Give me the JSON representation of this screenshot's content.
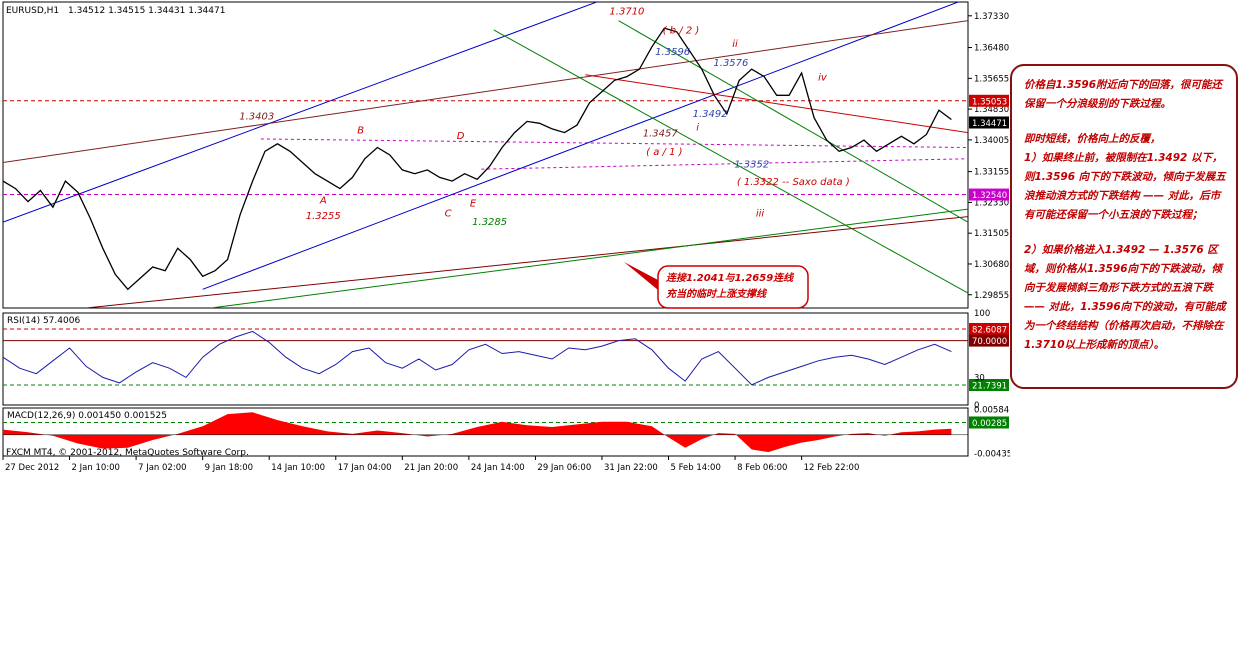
{
  "chart_data": {
    "type": "line",
    "symbol": "EURUSD,H1",
    "ohlc_readout": "1.34512 1.34515 1.34431 1.34471",
    "price_axis_ticks": [
      "1.37330",
      "1.36480",
      "1.35655",
      "1.34830",
      "1.34005",
      "1.33155",
      "1.32330",
      "1.31505",
      "1.30680",
      "1.29855"
    ],
    "price_badges": [
      {
        "value": "1.35053",
        "color": "#cc0000"
      },
      {
        "value": "1.34471",
        "color": "#000000"
      },
      {
        "value": "1.32540",
        "color": "#cc00cc"
      }
    ],
    "ylim": [
      1.295,
      1.377
    ],
    "series_close": [
      [
        0,
        1.329
      ],
      [
        3,
        1.327
      ],
      [
        6,
        1.3235
      ],
      [
        9,
        1.3265
      ],
      [
        12,
        1.322
      ],
      [
        15,
        1.329
      ],
      [
        18,
        1.326
      ],
      [
        21,
        1.319
      ],
      [
        24,
        1.311
      ],
      [
        27,
        1.304
      ],
      [
        30,
        1.3
      ],
      [
        33,
        1.303
      ],
      [
        36,
        1.306
      ],
      [
        39,
        1.305
      ],
      [
        42,
        1.311
      ],
      [
        45,
        1.308
      ],
      [
        48,
        1.3035
      ],
      [
        51,
        1.305
      ],
      [
        54,
        1.308
      ],
      [
        57,
        1.32
      ],
      [
        60,
        1.329
      ],
      [
        63,
        1.337
      ],
      [
        66,
        1.339
      ],
      [
        69,
        1.337
      ],
      [
        72,
        1.334
      ],
      [
        75,
        1.331
      ],
      [
        78,
        1.329
      ],
      [
        81,
        1.327
      ],
      [
        84,
        1.33
      ],
      [
        87,
        1.335
      ],
      [
        90,
        1.338
      ],
      [
        93,
        1.336
      ],
      [
        96,
        1.332
      ],
      [
        99,
        1.331
      ],
      [
        102,
        1.332
      ],
      [
        105,
        1.33
      ],
      [
        108,
        1.329
      ],
      [
        111,
        1.331
      ],
      [
        114,
        1.3295
      ],
      [
        117,
        1.333
      ],
      [
        120,
        1.338
      ],
      [
        123,
        1.342
      ],
      [
        126,
        1.345
      ],
      [
        129,
        1.3445
      ],
      [
        132,
        1.343
      ],
      [
        135,
        1.342
      ],
      [
        138,
        1.344
      ],
      [
        141,
        1.35
      ],
      [
        144,
        1.353
      ],
      [
        147,
        1.356
      ],
      [
        150,
        1.357
      ],
      [
        153,
        1.359
      ],
      [
        156,
        1.365
      ],
      [
        159,
        1.37
      ],
      [
        162,
        1.369
      ],
      [
        165,
        1.364
      ],
      [
        168,
        1.359
      ],
      [
        171,
        1.352
      ],
      [
        174,
        1.347
      ],
      [
        177,
        1.356
      ],
      [
        180,
        1.359
      ],
      [
        183,
        1.357
      ],
      [
        186,
        1.352
      ],
      [
        189,
        1.352
      ],
      [
        192,
        1.358
      ],
      [
        195,
        1.346
      ],
      [
        198,
        1.34
      ],
      [
        201,
        1.337
      ],
      [
        204,
        1.338
      ],
      [
        207,
        1.34
      ],
      [
        210,
        1.337
      ],
      [
        213,
        1.339
      ],
      [
        216,
        1.341
      ],
      [
        219,
        1.339
      ],
      [
        222,
        1.3415
      ],
      [
        225,
        1.348
      ],
      [
        228,
        1.3455
      ]
    ],
    "x_ticks": [
      {
        "i": 0,
        "label": "27 Dec 2012"
      },
      {
        "i": 16,
        "label": "2 Jan 10:00"
      },
      {
        "i": 32,
        "label": "7 Jan 02:00"
      },
      {
        "i": 48,
        "label": "9 Jan 18:00"
      },
      {
        "i": 64,
        "label": "14 Jan 10:00"
      },
      {
        "i": 80,
        "label": "17 Jan 04:00"
      },
      {
        "i": 96,
        "label": "21 Jan 20:00"
      },
      {
        "i": 112,
        "label": "24 Jan 14:00"
      },
      {
        "i": 128,
        "label": "29 Jan 06:00"
      },
      {
        "i": 144,
        "label": "31 Jan 22:00"
      },
      {
        "i": 160,
        "label": "5 Feb 14:00"
      },
      {
        "i": 176,
        "label": "8 Feb 06:00"
      },
      {
        "i": 192,
        "label": "12 Feb 22:00"
      }
    ],
    "x_max": 232,
    "trendlines": [
      {
        "p1": [
          0,
          1.318
        ],
        "p2": [
          150,
          1.38
        ],
        "color": "#0000cc"
      },
      {
        "p1": [
          48,
          1.3
        ],
        "p2": [
          232,
          1.378
        ],
        "color": "#0000cc"
      },
      {
        "p1": [
          0,
          1.334
        ],
        "p2": [
          232,
          1.372
        ],
        "color": "#802020"
      },
      {
        "p1": [
          140,
          1.3575
        ],
        "p2": [
          232,
          1.342
        ],
        "color": "#cc0000"
      },
      {
        "p1": [
          20,
          1.295
        ],
        "p2": [
          232,
          1.3195
        ],
        "color": "#800000"
      },
      {
        "p1": [
          50,
          1.295
        ],
        "p2": [
          232,
          1.3215
        ],
        "color": "#008000"
      },
      {
        "p1": [
          118,
          1.3695
        ],
        "p2": [
          232,
          1.299
        ],
        "color": "#008000"
      },
      {
        "p1": [
          148,
          1.372
        ],
        "p2": [
          232,
          1.318
        ],
        "color": "#008000"
      }
    ],
    "dashed_levels": [
      {
        "y": 1.35053,
        "color": "#cc0000"
      },
      {
        "y": 1.3254,
        "color": "#cc00cc"
      }
    ],
    "dashed_lines": [
      {
        "p1": [
          115,
          1.3322
        ],
        "p2": [
          232,
          1.335
        ],
        "color": "#cc00cc"
      },
      {
        "p1": [
          62,
          1.3403
        ],
        "p2": [
          232,
          1.338
        ],
        "color": "#cc00cc"
      }
    ],
    "annotations": [
      {
        "text": "1.3710",
        "i": 150,
        "y": 1.3736,
        "color": "#cc0000"
      },
      {
        "text": "( b / 2 )",
        "i": 163,
        "y": 1.3685,
        "color": "#cc0000"
      },
      {
        "text": "1.3596",
        "i": 161,
        "y": 1.3628,
        "color": "#3344aa"
      },
      {
        "text": "ii",
        "i": 176,
        "y": 1.365,
        "color": "#cc0000"
      },
      {
        "text": "1.3576",
        "i": 175,
        "y": 1.3598,
        "color": "#3344aa"
      },
      {
        "text": "iv",
        "i": 197,
        "y": 1.356,
        "color": "#cc0000"
      },
      {
        "text": "1.3403",
        "i": 61,
        "y": 1.3455,
        "color": "#802020"
      },
      {
        "text": "B",
        "i": 86,
        "y": 1.3418,
        "color": "#cc0000"
      },
      {
        "text": "D",
        "i": 110,
        "y": 1.3403,
        "color": "#cc0000"
      },
      {
        "text": "1.3492",
        "i": 170,
        "y": 1.3462,
        "color": "#3344aa"
      },
      {
        "text": "i",
        "i": 167,
        "y": 1.3425,
        "color": "#cc0000"
      },
      {
        "text": "1.3457",
        "i": 158,
        "y": 1.341,
        "color": "#802020"
      },
      {
        "text": "( a / 1 )",
        "i": 159,
        "y": 1.336,
        "color": "#cc0000"
      },
      {
        "text": "1.3352",
        "i": 180,
        "y": 1.3327,
        "color": "#3344aa"
      },
      {
        "text": "( 1.3322 -- Saxo data )",
        "i": 190,
        "y": 1.328,
        "color": "#cc0000"
      },
      {
        "text": "A",
        "i": 77,
        "y": 1.323,
        "color": "#cc0000"
      },
      {
        "text": "1.3255",
        "i": 77,
        "y": 1.3188,
        "color": "#cc0000"
      },
      {
        "text": "C",
        "i": 107,
        "y": 1.3195,
        "color": "#cc0000"
      },
      {
        "text": "E",
        "i": 113,
        "y": 1.3222,
        "color": "#cc0000"
      },
      {
        "text": "1.3285",
        "i": 117,
        "y": 1.3172,
        "color": "#008000"
      },
      {
        "text": "iii",
        "i": 182,
        "y": 1.3195,
        "color": "#cc0000"
      }
    ],
    "callout": {
      "lines": [
        "连接1.2041与1.2659连线",
        "充当的临时上涨支撑线"
      ],
      "color": "#cc0000"
    },
    "rsi": {
      "label": "RSI(14) 57.4006",
      "ylim": [
        0,
        100
      ],
      "ticks": [
        "100",
        "30",
        "0"
      ],
      "levels": [
        {
          "value": 82.6087,
          "label": "82.6087",
          "color": "#cc0000"
        },
        {
          "value": 70,
          "label": "70.0000",
          "color": "#800000"
        },
        {
          "value": 21.7391,
          "label": "21.7391",
          "color": "#008000"
        }
      ],
      "series": [
        [
          0,
          52
        ],
        [
          4,
          40
        ],
        [
          8,
          34
        ],
        [
          12,
          48
        ],
        [
          16,
          62
        ],
        [
          20,
          42
        ],
        [
          24,
          30
        ],
        [
          28,
          24
        ],
        [
          32,
          36
        ],
        [
          36,
          46
        ],
        [
          40,
          40
        ],
        [
          44,
          30
        ],
        [
          48,
          52
        ],
        [
          52,
          66
        ],
        [
          56,
          74
        ],
        [
          60,
          80
        ],
        [
          64,
          68
        ],
        [
          68,
          52
        ],
        [
          72,
          40
        ],
        [
          76,
          34
        ],
        [
          80,
          44
        ],
        [
          84,
          58
        ],
        [
          88,
          62
        ],
        [
          92,
          46
        ],
        [
          96,
          40
        ],
        [
          100,
          50
        ],
        [
          104,
          38
        ],
        [
          108,
          44
        ],
        [
          112,
          60
        ],
        [
          116,
          66
        ],
        [
          120,
          56
        ],
        [
          124,
          58
        ],
        [
          128,
          54
        ],
        [
          132,
          50
        ],
        [
          136,
          62
        ],
        [
          140,
          60
        ],
        [
          144,
          64
        ],
        [
          148,
          70
        ],
        [
          152,
          72
        ],
        [
          156,
          60
        ],
        [
          160,
          40
        ],
        [
          164,
          26
        ],
        [
          168,
          50
        ],
        [
          172,
          58
        ],
        [
          176,
          40
        ],
        [
          180,
          22
        ],
        [
          184,
          30
        ],
        [
          188,
          36
        ],
        [
          192,
          42
        ],
        [
          196,
          48
        ],
        [
          200,
          52
        ],
        [
          204,
          54
        ],
        [
          208,
          50
        ],
        [
          212,
          44
        ],
        [
          216,
          52
        ],
        [
          220,
          60
        ],
        [
          224,
          66
        ],
        [
          228,
          58
        ]
      ]
    },
    "macd": {
      "label": "MACD(12,26,9) 0.001450 0.001525",
      "ylim": [
        -0.0049,
        0.0062
      ],
      "ticks": [
        "0.00584",
        "-0.00435"
      ],
      "levels": [
        {
          "value": 0.00285,
          "label": "0.00285",
          "color": "#008000"
        }
      ],
      "hist": [
        [
          0,
          0.0012
        ],
        [
          6,
          0.0006
        ],
        [
          12,
          -0.0002
        ],
        [
          18,
          -0.002
        ],
        [
          24,
          -0.0032
        ],
        [
          30,
          -0.003
        ],
        [
          36,
          -0.0012
        ],
        [
          42,
          0.0002
        ],
        [
          48,
          0.002
        ],
        [
          54,
          0.0048
        ],
        [
          60,
          0.0052
        ],
        [
          66,
          0.0034
        ],
        [
          72,
          0.002
        ],
        [
          78,
          0.0008
        ],
        [
          84,
          0.0002
        ],
        [
          90,
          0.001
        ],
        [
          96,
          0.0004
        ],
        [
          102,
          -0.0004
        ],
        [
          108,
          0.0002
        ],
        [
          114,
          0.0018
        ],
        [
          120,
          0.003
        ],
        [
          126,
          0.0022
        ],
        [
          132,
          0.0018
        ],
        [
          138,
          0.0024
        ],
        [
          144,
          0.003
        ],
        [
          150,
          0.003
        ],
        [
          156,
          0.002
        ],
        [
          160,
          -0.0006
        ],
        [
          164,
          -0.003
        ],
        [
          168,
          -0.001
        ],
        [
          172,
          0.0004
        ],
        [
          176,
          0.0002
        ],
        [
          180,
          -0.0034
        ],
        [
          184,
          -0.004
        ],
        [
          188,
          -0.0028
        ],
        [
          192,
          -0.0018
        ],
        [
          196,
          -0.0012
        ],
        [
          200,
          -0.0004
        ],
        [
          204,
          0.0002
        ],
        [
          208,
          0.0004
        ],
        [
          212,
          -0.0002
        ],
        [
          216,
          0.0006
        ],
        [
          220,
          0.0008
        ],
        [
          224,
          0.0012
        ],
        [
          228,
          0.0014
        ]
      ]
    },
    "footer": "FXCM MT4, © 2001-2012, MetaQuotes Software Corp."
  },
  "note": {
    "p1": "价格自1.3596附近向下的回落，很可能还保留一个分浪级别的下跌过程。",
    "p2": "即时短线，价格向上的反覆，",
    "p3": "1）如果终止前，被限制在1.3492 以下，则1.3596 向下的下跌波动，倾向于发展五浪推动浪方式的下跌结构 —— 对此，后市有可能还保留一个小五浪的下跌过程；",
    "p4": "2）如果价格进入1.3492 — 1.3576 区域，则价格从1.3596向下的下跌波动，倾向于发展倾斜三角形下跌方式的五浪下跌 —— 对此，1.3596向下的波动，有可能成为一个终结结构（价格再次启动，不排除在1.3710以上形成新的顶点）。"
  }
}
